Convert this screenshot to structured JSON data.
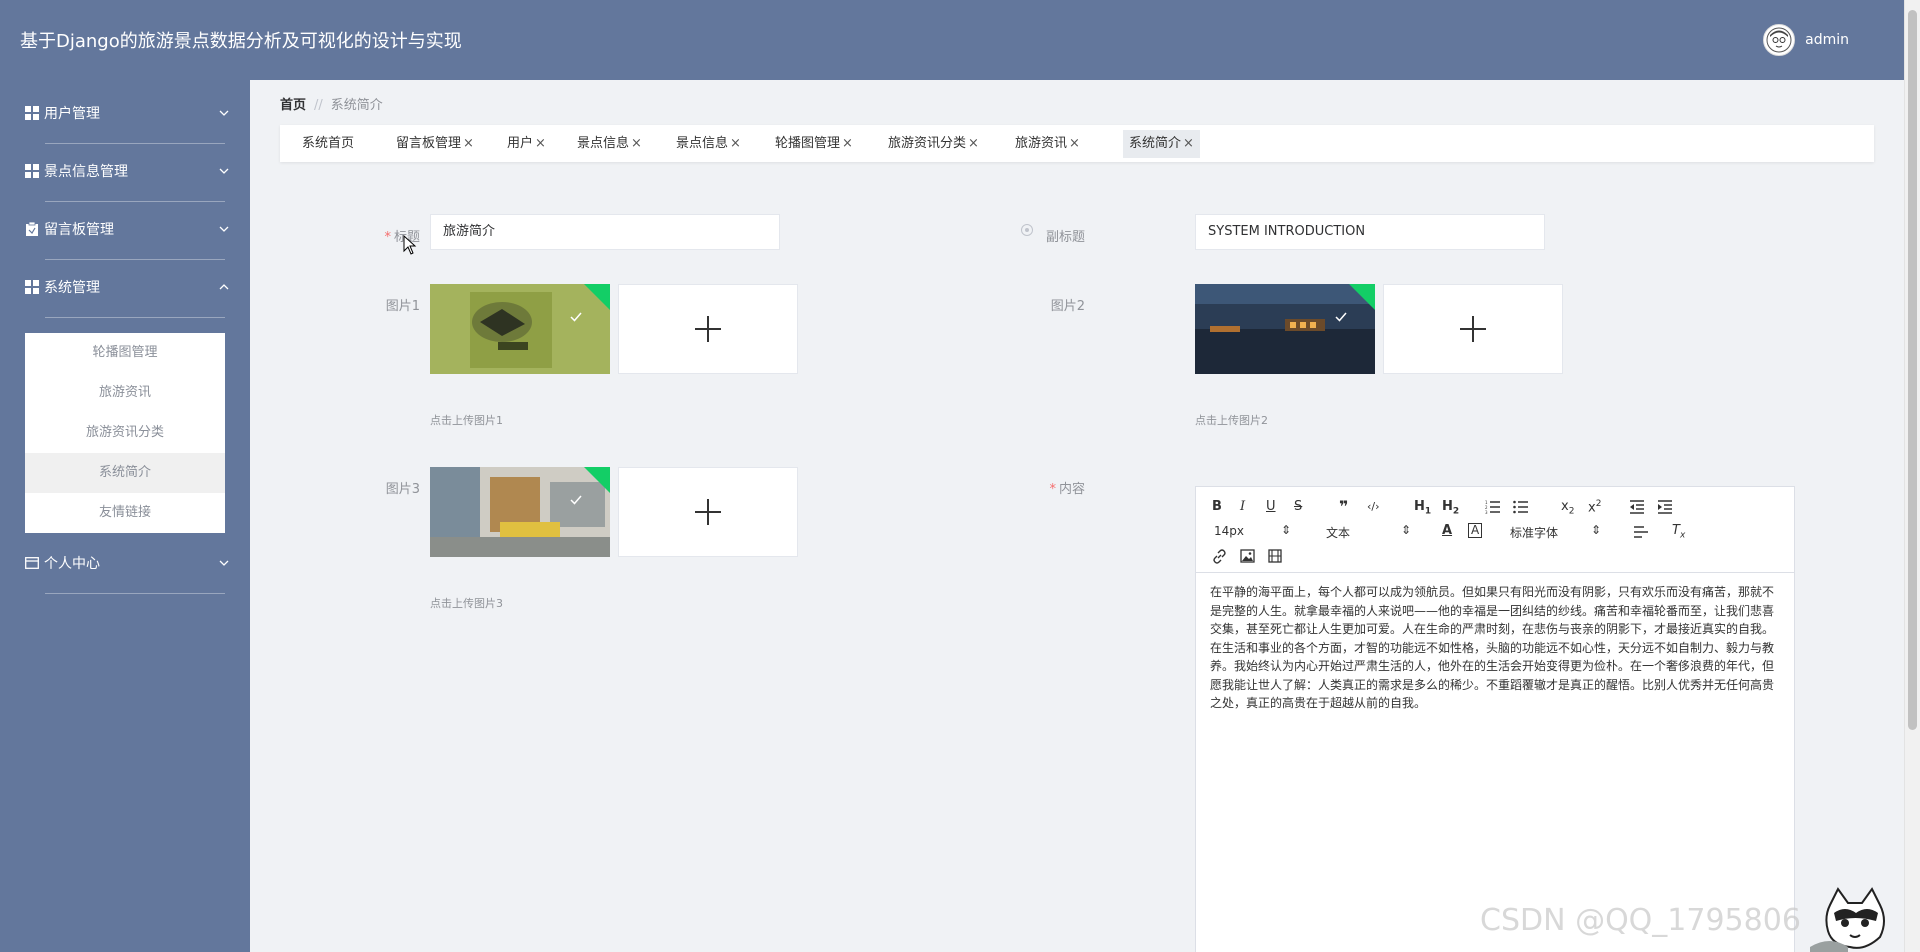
{
  "header": {
    "title": "基于Django的旅游景点数据分析及可视化的设计与实现",
    "username": "admin"
  },
  "sidebar": {
    "items": [
      {
        "label": "用户管理"
      },
      {
        "label": "景点信息管理"
      },
      {
        "label": "留言板管理"
      },
      {
        "label": "系统管理"
      },
      {
        "label": "个人中心"
      }
    ],
    "submenu": [
      {
        "label": "轮播图管理"
      },
      {
        "label": "旅游资讯"
      },
      {
        "label": "旅游资讯分类"
      },
      {
        "label": "系统简介"
      },
      {
        "label": "友情链接"
      }
    ]
  },
  "breadcrumb": {
    "home": "首页",
    "separator": "//",
    "current": "系统简介"
  },
  "tabs": [
    {
      "label": "系统首页",
      "closable": false
    },
    {
      "label": "留言板管理",
      "closable": true
    },
    {
      "label": "用户",
      "closable": true
    },
    {
      "label": "景点信息",
      "closable": true
    },
    {
      "label": "景点信息",
      "closable": true
    },
    {
      "label": "轮播图管理",
      "closable": true
    },
    {
      "label": "旅游资讯分类",
      "closable": true
    },
    {
      "label": "旅游资讯",
      "closable": true
    },
    {
      "label": "系统简介",
      "closable": true,
      "active": true
    }
  ],
  "tab_close_glyph": "×",
  "form": {
    "title": {
      "label": "标题",
      "value": "旅游简介",
      "required": "*"
    },
    "subtitle": {
      "label": "副标题",
      "value": "SYSTEM INTRODUCTION"
    },
    "picture1": {
      "label": "图片1",
      "hint": "点击上传图片1"
    },
    "picture2": {
      "label": "图片2",
      "hint": "点击上传图片2"
    },
    "picture3": {
      "label": "图片3",
      "hint": "点击上传图片3"
    },
    "content": {
      "label": "内容",
      "required": "*"
    }
  },
  "editor": {
    "font_size": "14px",
    "text_type": "文本",
    "font_family": "标准字体",
    "content": "在平静的海平面上，每个人都可以成为领航员。但如果只有阳光而没有阴影，只有欢乐而没有痛苦，那就不是完整的人生。就拿最幸福的人来说吧——他的幸福是一团纠结的纱线。痛苦和幸福轮番而至，让我们悲喜交集，甚至死亡都让人生更加可爱。人在生命的严肃时刻，在悲伤与丧亲的阴影下，才最接近真实的自我。在生活和事业的各个方面，才智的功能远不如性格，头脑的功能远不如心性，天分远不如自制力、毅力与教养。我始终认为内心开始过严肃生活的人，他外在的生活会开始变得更为俭朴。在一个奢侈浪费的年代，但愿我能让世人了解：人类真正的需求是多么的稀少。不重蹈覆辙才是真正的醒悟。比别人优秀并无任何高贵之处，真正的高贵在于超越从前的自我。"
  },
  "watermark": "CSDN @QQ_1795806",
  "colors": {
    "header_bg": "#63779c",
    "sidebar_bg": "#63779c",
    "main_bg": "#f0f2f5",
    "required": "#f56c6c",
    "corner_badge": "#13ce66"
  }
}
